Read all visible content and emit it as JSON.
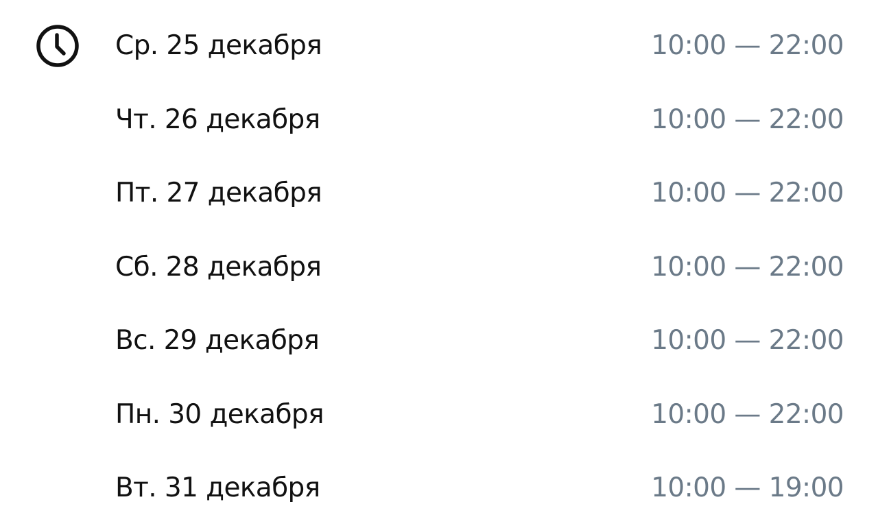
{
  "schedule": {
    "icon": "clock-icon",
    "days": [
      {
        "day": "Ср. 25 декабря",
        "hours": "10:00 — 22:00"
      },
      {
        "day": "Чт. 26 декабря",
        "hours": "10:00 — 22:00"
      },
      {
        "day": "Пт. 27 декабря",
        "hours": "10:00 — 22:00"
      },
      {
        "day": "Сб. 28 декабря",
        "hours": "10:00 — 22:00"
      },
      {
        "day": "Вс. 29 декабря",
        "hours": "10:00 — 22:00"
      },
      {
        "day": "Пн. 30 декабря",
        "hours": "10:00 — 22:00"
      },
      {
        "day": "Вт. 31 декабря",
        "hours": "10:00 — 19:00"
      }
    ]
  },
  "colors": {
    "day_text": "#111111",
    "hours_text": "#6b7a88",
    "background": "#ffffff"
  }
}
